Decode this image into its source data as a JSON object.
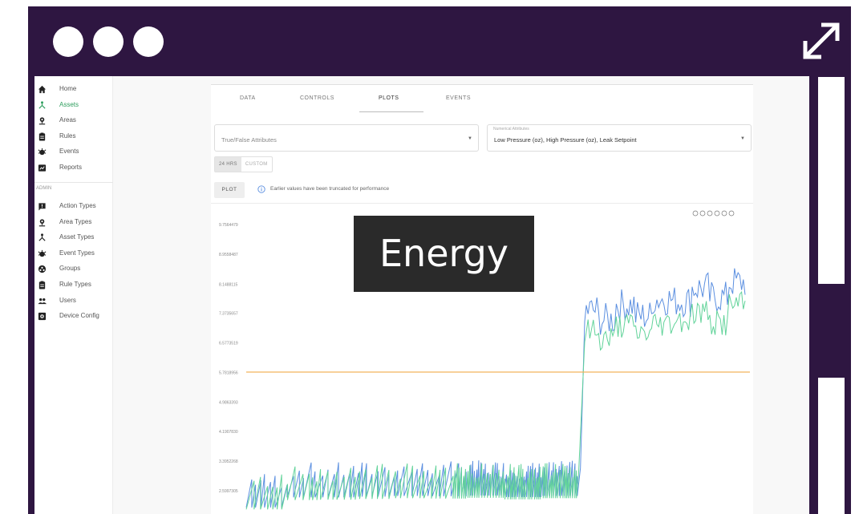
{
  "sidebar": {
    "items": [
      {
        "label": "Home",
        "icon": "home-icon"
      },
      {
        "label": "Assets",
        "icon": "asset-tree-icon"
      },
      {
        "label": "Areas",
        "icon": "location-pin-icon"
      },
      {
        "label": "Rules",
        "icon": "clipboard-icon"
      },
      {
        "label": "Events",
        "icon": "alarm-icon"
      },
      {
        "label": "Reports",
        "icon": "report-icon"
      }
    ],
    "admin_section": "ADMIN",
    "admin_items": [
      {
        "label": "Action Types",
        "icon": "action-flag-icon"
      },
      {
        "label": "Area Types",
        "icon": "location-pin-icon"
      },
      {
        "label": "Asset Types",
        "icon": "asset-tree-icon"
      },
      {
        "label": "Event Types",
        "icon": "alarm-icon"
      },
      {
        "label": "Groups",
        "icon": "groups-icon"
      },
      {
        "label": "Rule Types",
        "icon": "clipboard-icon"
      },
      {
        "label": "Users",
        "icon": "users-icon"
      },
      {
        "label": "Device Config",
        "icon": "device-config-icon"
      }
    ],
    "active_item": "Assets"
  },
  "tabs": [
    "DATA",
    "CONTROLS",
    "PLOTS",
    "EVENTS"
  ],
  "active_tab": "PLOTS",
  "boolean_select": {
    "placeholder": "True/False Attributes"
  },
  "numerical_select": {
    "label": "Numerical Attributes",
    "value": "Low Pressure (oz), High Pressure (oz), Leak Setpoint"
  },
  "range_toggle": {
    "options": [
      "24 HRS",
      "CUSTOM"
    ],
    "selected": "24 HRS"
  },
  "plot_button": "PLOT",
  "info_message": "Earlier values have been truncated for performance",
  "chart_toolbar_icons": [
    "zoom-in-icon",
    "zoom-out-icon",
    "magnify-icon",
    "pan-icon",
    "home-icon",
    "menu-icon"
  ],
  "overlay_caption": "Energy",
  "colors": {
    "frame": "#2e1641",
    "accent_active": "#2e9e5e",
    "series_high": "#5b8fe0",
    "series_low": "#62d39a",
    "series_setpoint": "#f2b35c"
  },
  "chart_data": {
    "type": "line",
    "y_tick_labels": [
      "9.7564479",
      "8.9558487",
      "8.1488115",
      "7.3735657",
      "6.5773519",
      "5.7818956",
      "4.9863393",
      "4.1907830",
      "3.3952268",
      "2.5997305"
    ],
    "ylim": [
      2.5997305,
      9.7564479
    ],
    "series": [
      {
        "values": [
          2.35,
          2.62,
          2.62,
          2.64,
          2.66,
          2.65,
          2.67,
          2.63,
          2.66,
          7.45,
          7.2,
          7.6,
          7.3,
          7.75,
          7.7,
          8.05,
          7.8,
          8.2
        ]
      },
      {
        "values": [
          2.3,
          2.55,
          2.56,
          2.58,
          2.6,
          2.59,
          2.61,
          2.57,
          2.6,
          6.9,
          6.7,
          7.05,
          6.85,
          7.1,
          7.2,
          7.4,
          7.1,
          7.6
        ]
      },
      {
        "values": [
          5.79,
          5.79
        ]
      }
    ]
  }
}
